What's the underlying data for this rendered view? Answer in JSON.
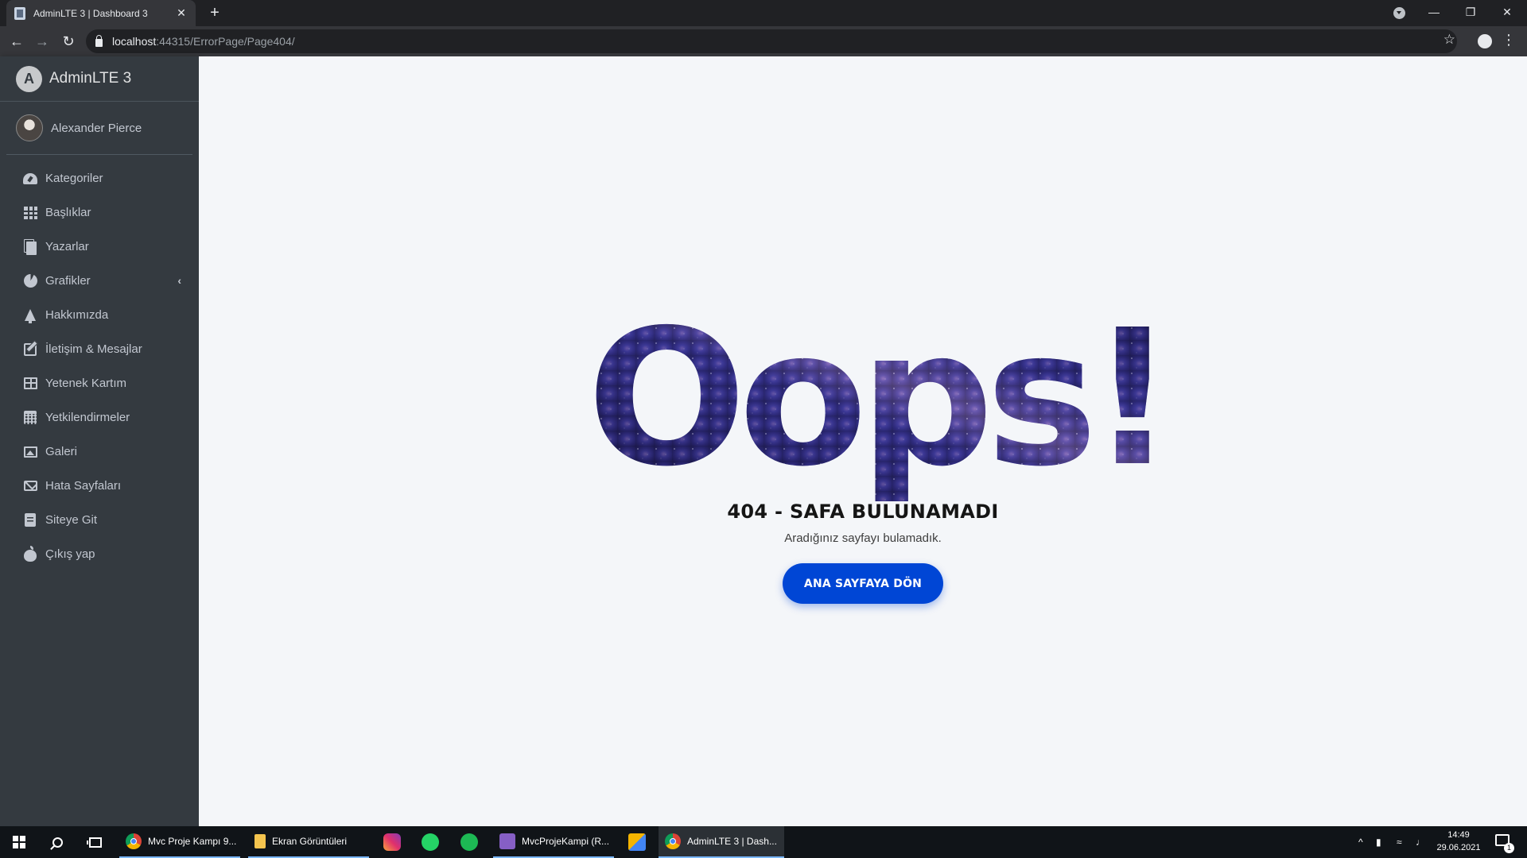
{
  "browser": {
    "tab_title": "AdminLTE 3 | Dashboard 3",
    "tab_close": "✕",
    "new_tab": "+",
    "url_host": "localhost",
    "url_rest": ":44315/ErrorPage/Page404/"
  },
  "sidebar": {
    "brand": "AdminLTE 3",
    "brand_logo_letter": "A",
    "user_name": "Alexander Pierce",
    "items": [
      {
        "label": "Kategoriler",
        "icon": "tachometer-icon"
      },
      {
        "label": "Başlıklar",
        "icon": "th-grid-icon"
      },
      {
        "label": "Yazarlar",
        "icon": "copy-icon"
      },
      {
        "label": "Grafikler",
        "icon": "chart-pie-icon",
        "arrow": "‹"
      },
      {
        "label": "Hakkımızda",
        "icon": "tree-icon"
      },
      {
        "label": "İletişim & Mesajlar",
        "icon": "edit-icon"
      },
      {
        "label": "Yetenek Kartım",
        "icon": "table-icon"
      },
      {
        "label": "Yetkilendirmeler",
        "icon": "calendar-icon"
      },
      {
        "label": "Galeri",
        "icon": "image-icon"
      },
      {
        "label": "Hata Sayfaları",
        "icon": "envelope-icon"
      },
      {
        "label": "Siteye Git",
        "icon": "book-icon"
      },
      {
        "label": "Çıkış yap",
        "icon": "apple-icon"
      }
    ]
  },
  "error": {
    "headline": "Oops!",
    "title": "404 - SAFA BULUNAMADI",
    "subtitle": "Aradığınız sayfayı bulamadık.",
    "button": "ANA SAYFAYA DÖN"
  },
  "taskbar": {
    "apps": [
      {
        "label": "Mvc Proje Kampı 9..."
      },
      {
        "label": "Ekran Görüntüleri"
      },
      {
        "label": "MvcProjeKampi (R..."
      },
      {
        "label": "AdminLTE 3 | Dash..."
      }
    ],
    "time": "14:49",
    "date": "29.06.2021",
    "notification_count": "1",
    "tray_caret": "^"
  },
  "colors": {
    "sidebar_bg": "#343a40",
    "content_bg": "#f4f6f9",
    "button_bg": "#0046d5",
    "galaxy_dark": "#1a1747",
    "galaxy_mid": "#3b3894"
  }
}
